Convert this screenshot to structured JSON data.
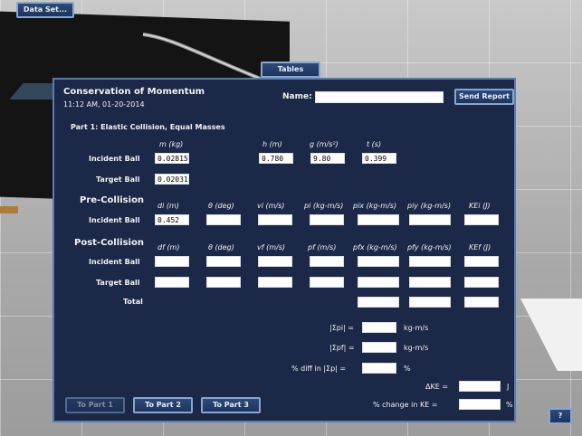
{
  "header": {
    "dataset_button": "Data Set...",
    "tables_tab": "Tables"
  },
  "panel": {
    "title": "Conservation of Momentum",
    "timestamp": "11:12 AM, 01-20-2014",
    "name_label": "Name:",
    "name_value": "",
    "send_report": "Send Report",
    "part_title": "Part 1: Elastic Collision, Equal Masses",
    "cols_top": {
      "m": "m (kg)",
      "h": "h (m)",
      "g": "g (m/s²)",
      "t": "t (s)"
    },
    "incident_ball_label": "Incident Ball",
    "target_ball_label": "Target Ball",
    "values": {
      "m_incident": "0.02815",
      "h": "0.780",
      "g": "9.80",
      "t": "0.399",
      "m_target": "0.02031",
      "di_incident": "0.452"
    },
    "pre_collision": "Pre-Collision",
    "pre_cols": [
      "di (m)",
      "θ (deg)",
      "vi (m/s)",
      "pi (kg-m/s)",
      "pix (kg-m/s)",
      "piy (kg-m/s)",
      "KEi (J)"
    ],
    "post_collision": "Post-Collision",
    "post_cols": [
      "df (m)",
      "θ (deg)",
      "vf (m/s)",
      "pf (m/s)",
      "pfx (kg-m/s)",
      "pfy (kg-m/s)",
      "KEf (J)"
    ],
    "total_label": "Total",
    "sum_pi": "|Σpi| =",
    "sum_pf": "|Σpf| =",
    "unit_kgms": "kg-m/s",
    "pct_diff": "% diff in |Σp| =",
    "pct": "%",
    "delta_ke": "ΔKE =",
    "unit_j": "J",
    "pct_change_ke": "% change in KE =",
    "nav": {
      "part1": "To Part 1",
      "part2": "To Part 2",
      "part3": "To Part 3"
    }
  },
  "help": "?"
}
